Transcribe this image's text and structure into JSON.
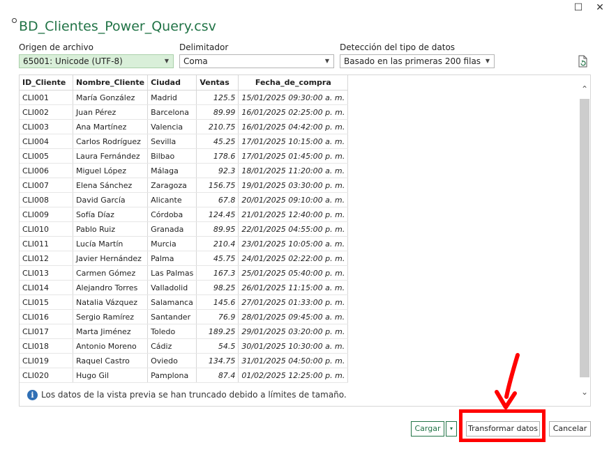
{
  "window": {
    "title": "BD_Clientes_Power_Query.csv",
    "maximize_glyph": "☐",
    "close_glyph": "✕"
  },
  "controls": {
    "origin": {
      "label": "Origen de archivo",
      "value": "65001: Unicode (UTF-8)"
    },
    "delimiter": {
      "label": "Delimitador",
      "value": "Coma"
    },
    "detection": {
      "label": "Detección del tipo de datos",
      "value": "Basado en las primeras 200 filas"
    }
  },
  "table": {
    "columns": [
      "ID_Cliente",
      "Nombre_Cliente",
      "Ciudad",
      "Ventas",
      "Fecha_de_compra"
    ],
    "rows": [
      [
        "CLI001",
        "María González",
        "Madrid",
        "125.5",
        "15/01/2025 09:30:00 a. m."
      ],
      [
        "CLI002",
        "Juan Pérez",
        "Barcelona",
        "89.99",
        "16/01/2025 02:25:00 p. m."
      ],
      [
        "CLI003",
        "Ana Martínez",
        "Valencia",
        "210.75",
        "16/01/2025 04:42:00 p. m."
      ],
      [
        "CLI004",
        "Carlos Rodríguez",
        "Sevilla",
        "45.25",
        "17/01/2025 10:15:00 a. m."
      ],
      [
        "CLI005",
        "Laura Fernández",
        "Bilbao",
        "178.6",
        "17/01/2025 01:45:00 p. m."
      ],
      [
        "CLI006",
        "Miguel López",
        "Málaga",
        "92.3",
        "18/01/2025 11:20:00 a. m."
      ],
      [
        "CLI007",
        "Elena Sánchez",
        "Zaragoza",
        "156.75",
        "19/01/2025 03:30:00 p. m."
      ],
      [
        "CLI008",
        "David García",
        "Alicante",
        "67.8",
        "20/01/2025 09:10:00 a. m."
      ],
      [
        "CLI009",
        "Sofía Díaz",
        "Córdoba",
        "124.45",
        "21/01/2025 12:40:00 p. m."
      ],
      [
        "CLI010",
        "Pablo Ruiz",
        "Granada",
        "89.95",
        "22/01/2025 04:55:00 p. m."
      ],
      [
        "CLI011",
        "Lucía Martín",
        "Murcia",
        "210.4",
        "23/01/2025 10:05:00 a. m."
      ],
      [
        "CLI012",
        "Javier Hernández",
        "Palma",
        "45.75",
        "24/01/2025 02:22:00 p. m."
      ],
      [
        "CLI013",
        "Carmen Gómez",
        "Las Palmas",
        "167.3",
        "25/01/2025 05:40:00 p. m."
      ],
      [
        "CLI014",
        "Alejandro Torres",
        "Valladolid",
        "98.25",
        "26/01/2025 11:15:00 a. m."
      ],
      [
        "CLI015",
        "Natalia Vázquez",
        "Salamanca",
        "145.6",
        "27/01/2025 01:33:00 p. m."
      ],
      [
        "CLI016",
        "Sergio Ramírez",
        "Santander",
        "76.9",
        "28/01/2025 09:45:00 a. m."
      ],
      [
        "CLI017",
        "Marta Jiménez",
        "Toledo",
        "189.25",
        "29/01/2025 03:20:00 p. m."
      ],
      [
        "CLI018",
        "Antonio Moreno",
        "Cádiz",
        "54.5",
        "30/01/2025 10:30:00 a. m."
      ],
      [
        "CLI019",
        "Raquel Castro",
        "Oviedo",
        "134.75",
        "31/01/2025 04:50:00 p. m."
      ],
      [
        "CLI020",
        "Hugo Gil",
        "Pamplona",
        "87.4",
        "01/02/2025 12:25:00 p. m."
      ]
    ]
  },
  "notice": {
    "icon": "info-icon",
    "text": "Los datos de la vista previa se han truncado debido a límites de tamaño."
  },
  "buttons": {
    "load": "Cargar",
    "load_dropdown_glyph": "▾",
    "transform": "Transformar datos",
    "cancel": "Cancelar"
  },
  "colors": {
    "accent": "#217346",
    "highlight": "#ff0000"
  }
}
